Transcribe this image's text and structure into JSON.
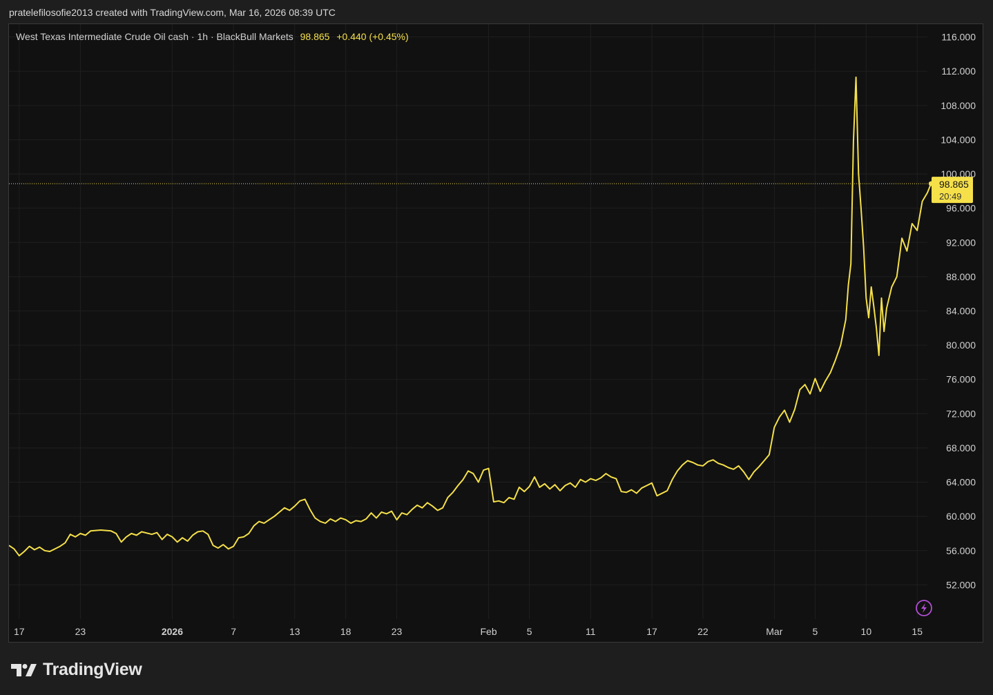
{
  "header": {
    "caption": "pratelefilosofie2013 created with TradingView.com, Mar 16, 2026 08:39 UTC"
  },
  "legend": {
    "symbol": "West Texas Intermediate Crude Oil cash · 1h · BlackBull Markets",
    "last": "98.865",
    "change": "+0.440 (+0.45%)"
  },
  "price_label": {
    "price": "98.865",
    "countdown": "20:49"
  },
  "footer": {
    "brand": "TradingView"
  },
  "colors": {
    "line": "#f5e04a",
    "background": "#111111",
    "grid": "#1f1f1f",
    "axis_text": "#d1d1d1"
  },
  "chart_data": {
    "type": "line",
    "title": "West Texas Intermediate Crude Oil cash · 1h · BlackBull Markets",
    "xlabel": "",
    "ylabel": "",
    "ylim": [
      48,
      117.5
    ],
    "yticks": [
      52,
      56,
      60,
      64,
      68,
      72,
      76,
      80,
      84,
      88,
      92,
      96,
      100,
      104,
      108,
      112,
      116
    ],
    "ytick_labels": [
      "52.000",
      "56.000",
      "60.000",
      "64.000",
      "68.000",
      "72.000",
      "76.000",
      "80.000",
      "84.000",
      "88.000",
      "92.000",
      "96.000",
      "100.000",
      "104.000",
      "108.000",
      "112.000",
      "116.000"
    ],
    "xlim": [
      "2025-12-16",
      "2026-03-16"
    ],
    "x_ticks": [
      {
        "date": "2025-12-17",
        "label": "17",
        "bold": false
      },
      {
        "date": "2025-12-23",
        "label": "23",
        "bold": false
      },
      {
        "date": "2026-01-01",
        "label": "2026",
        "bold": true
      },
      {
        "date": "2026-01-07",
        "label": "7",
        "bold": false
      },
      {
        "date": "2026-01-13",
        "label": "13",
        "bold": false
      },
      {
        "date": "2026-01-18",
        "label": "18",
        "bold": false
      },
      {
        "date": "2026-01-23",
        "label": "23",
        "bold": false
      },
      {
        "date": "2026-02-01",
        "label": "Feb",
        "bold": false
      },
      {
        "date": "2026-02-05",
        "label": "5",
        "bold": false
      },
      {
        "date": "2026-02-11",
        "label": "11",
        "bold": false
      },
      {
        "date": "2026-02-17",
        "label": "17",
        "bold": false
      },
      {
        "date": "2026-02-22",
        "label": "22",
        "bold": false
      },
      {
        "date": "2026-03-01",
        "label": "Mar",
        "bold": false
      },
      {
        "date": "2026-03-05",
        "label": "5",
        "bold": false
      },
      {
        "date": "2026-03-10",
        "label": "10",
        "bold": false
      },
      {
        "date": "2026-03-15",
        "label": "15",
        "bold": false
      }
    ],
    "last_value": 98.865,
    "grid": true,
    "series": [
      {
        "values": [
          [
            "2025-12-16 00:00",
            56.6
          ],
          [
            "2025-12-16 12:00",
            56.2
          ],
          [
            "2025-12-17 00:00",
            55.4
          ],
          [
            "2025-12-17 12:00",
            55.9
          ],
          [
            "2025-12-18 00:00",
            56.5
          ],
          [
            "2025-12-18 12:00",
            56.1
          ],
          [
            "2025-12-19 00:00",
            56.4
          ],
          [
            "2025-12-19 12:00",
            56.0
          ],
          [
            "2025-12-20 00:00",
            55.9
          ],
          [
            "2025-12-21 00:00",
            56.5
          ],
          [
            "2025-12-21 12:00",
            56.9
          ],
          [
            "2025-12-22 00:00",
            57.9
          ],
          [
            "2025-12-22 12:00",
            57.6
          ],
          [
            "2025-12-23 00:00",
            58.0
          ],
          [
            "2025-12-23 12:00",
            57.8
          ],
          [
            "2025-12-24 00:00",
            58.3
          ],
          [
            "2025-12-25 00:00",
            58.4
          ],
          [
            "2025-12-26 00:00",
            58.3
          ],
          [
            "2025-12-26 12:00",
            58.0
          ],
          [
            "2025-12-27 00:00",
            57.0
          ],
          [
            "2025-12-27 12:00",
            57.6
          ],
          [
            "2025-12-28 00:00",
            58.0
          ],
          [
            "2025-12-28 12:00",
            57.8
          ],
          [
            "2025-12-29 00:00",
            58.2
          ],
          [
            "2025-12-30 00:00",
            57.9
          ],
          [
            "2025-12-30 12:00",
            58.1
          ],
          [
            "2025-12-31 00:00",
            57.3
          ],
          [
            "2025-12-31 12:00",
            57.9
          ],
          [
            "2026-01-01 00:00",
            57.6
          ],
          [
            "2026-01-01 12:00",
            57.0
          ],
          [
            "2026-01-02 00:00",
            57.5
          ],
          [
            "2026-01-02 12:00",
            57.1
          ],
          [
            "2026-01-03 00:00",
            57.8
          ],
          [
            "2026-01-03 12:00",
            58.2
          ],
          [
            "2026-01-04 00:00",
            58.3
          ],
          [
            "2026-01-04 12:00",
            57.9
          ],
          [
            "2026-01-05 00:00",
            56.6
          ],
          [
            "2026-01-05 12:00",
            56.3
          ],
          [
            "2026-01-06 00:00",
            56.7
          ],
          [
            "2026-01-06 12:00",
            56.2
          ],
          [
            "2026-01-07 00:00",
            56.5
          ],
          [
            "2026-01-07 12:00",
            57.5
          ],
          [
            "2026-01-08 00:00",
            57.6
          ],
          [
            "2026-01-08 12:00",
            58.0
          ],
          [
            "2026-01-09 00:00",
            58.9
          ],
          [
            "2026-01-09 12:00",
            59.4
          ],
          [
            "2026-01-10 00:00",
            59.2
          ],
          [
            "2026-01-10 12:00",
            59.6
          ],
          [
            "2026-01-11 00:00",
            60.0
          ],
          [
            "2026-01-11 12:00",
            60.5
          ],
          [
            "2026-01-12 00:00",
            61.0
          ],
          [
            "2026-01-12 12:00",
            60.7
          ],
          [
            "2026-01-13 00:00",
            61.2
          ],
          [
            "2026-01-13 12:00",
            61.8
          ],
          [
            "2026-01-14 00:00",
            62.0
          ],
          [
            "2026-01-14 12:00",
            60.8
          ],
          [
            "2026-01-15 00:00",
            59.8
          ],
          [
            "2026-01-15 12:00",
            59.4
          ],
          [
            "2026-01-16 00:00",
            59.2
          ],
          [
            "2026-01-16 12:00",
            59.7
          ],
          [
            "2026-01-17 00:00",
            59.4
          ],
          [
            "2026-01-17 12:00",
            59.8
          ],
          [
            "2026-01-18 00:00",
            59.6
          ],
          [
            "2026-01-18 12:00",
            59.2
          ],
          [
            "2026-01-19 00:00",
            59.5
          ],
          [
            "2026-01-19 12:00",
            59.4
          ],
          [
            "2026-01-20 00:00",
            59.7
          ],
          [
            "2026-01-20 12:00",
            60.4
          ],
          [
            "2026-01-21 00:00",
            59.8
          ],
          [
            "2026-01-21 12:00",
            60.5
          ],
          [
            "2026-01-22 00:00",
            60.3
          ],
          [
            "2026-01-22 12:00",
            60.6
          ],
          [
            "2026-01-23 00:00",
            59.6
          ],
          [
            "2026-01-23 12:00",
            60.4
          ],
          [
            "2026-01-24 00:00",
            60.2
          ],
          [
            "2026-01-24 12:00",
            60.8
          ],
          [
            "2026-01-25 00:00",
            61.3
          ],
          [
            "2026-01-25 12:00",
            61.0
          ],
          [
            "2026-01-26 00:00",
            61.6
          ],
          [
            "2026-01-26 12:00",
            61.2
          ],
          [
            "2026-01-27 00:00",
            60.7
          ],
          [
            "2026-01-27 12:00",
            61.0
          ],
          [
            "2026-01-28 00:00",
            62.2
          ],
          [
            "2026-01-28 12:00",
            62.8
          ],
          [
            "2026-01-29 00:00",
            63.6
          ],
          [
            "2026-01-29 12:00",
            64.3
          ],
          [
            "2026-01-30 00:00",
            65.3
          ],
          [
            "2026-01-30 12:00",
            65.0
          ],
          [
            "2026-01-31 00:00",
            64.0
          ],
          [
            "2026-01-31 12:00",
            65.4
          ],
          [
            "2026-02-01 00:00",
            65.6
          ],
          [
            "2026-02-01 12:00",
            61.7
          ],
          [
            "2026-02-02 00:00",
            61.8
          ],
          [
            "2026-02-02 12:00",
            61.6
          ],
          [
            "2026-02-03 00:00",
            62.2
          ],
          [
            "2026-02-03 12:00",
            62.0
          ],
          [
            "2026-02-04 00:00",
            63.4
          ],
          [
            "2026-02-04 12:00",
            62.9
          ],
          [
            "2026-02-05 00:00",
            63.5
          ],
          [
            "2026-02-05 12:00",
            64.6
          ],
          [
            "2026-02-06 00:00",
            63.4
          ],
          [
            "2026-02-06 12:00",
            63.8
          ],
          [
            "2026-02-07 00:00",
            63.2
          ],
          [
            "2026-02-07 12:00",
            63.7
          ],
          [
            "2026-02-08 00:00",
            63.0
          ],
          [
            "2026-02-08 12:00",
            63.6
          ],
          [
            "2026-02-09 00:00",
            63.9
          ],
          [
            "2026-02-09 12:00",
            63.4
          ],
          [
            "2026-02-10 00:00",
            64.3
          ],
          [
            "2026-02-10 12:00",
            64.0
          ],
          [
            "2026-02-11 00:00",
            64.4
          ],
          [
            "2026-02-11 12:00",
            64.2
          ],
          [
            "2026-02-12 00:00",
            64.5
          ],
          [
            "2026-02-12 12:00",
            65.0
          ],
          [
            "2026-02-13 00:00",
            64.6
          ],
          [
            "2026-02-13 12:00",
            64.4
          ],
          [
            "2026-02-14 00:00",
            62.9
          ],
          [
            "2026-02-14 12:00",
            62.8
          ],
          [
            "2026-02-15 00:00",
            63.1
          ],
          [
            "2026-02-15 12:00",
            62.7
          ],
          [
            "2026-02-16 00:00",
            63.3
          ],
          [
            "2026-02-16 12:00",
            63.6
          ],
          [
            "2026-02-17 00:00",
            63.9
          ],
          [
            "2026-02-17 12:00",
            62.4
          ],
          [
            "2026-02-18 00:00",
            62.7
          ],
          [
            "2026-02-18 12:00",
            63.0
          ],
          [
            "2026-02-19 00:00",
            64.3
          ],
          [
            "2026-02-19 12:00",
            65.3
          ],
          [
            "2026-02-20 00:00",
            66.0
          ],
          [
            "2026-02-20 12:00",
            66.5
          ],
          [
            "2026-02-21 00:00",
            66.3
          ],
          [
            "2026-02-21 12:00",
            66.0
          ],
          [
            "2026-02-22 00:00",
            65.9
          ],
          [
            "2026-02-22 12:00",
            66.4
          ],
          [
            "2026-02-23 00:00",
            66.6
          ],
          [
            "2026-02-23 12:00",
            66.2
          ],
          [
            "2026-02-24 00:00",
            66.0
          ],
          [
            "2026-02-24 12:00",
            65.7
          ],
          [
            "2026-02-25 00:00",
            65.5
          ],
          [
            "2026-02-25 12:00",
            65.9
          ],
          [
            "2026-02-26 00:00",
            65.2
          ],
          [
            "2026-02-26 12:00",
            64.3
          ],
          [
            "2026-02-27 00:00",
            65.2
          ],
          [
            "2026-02-27 12:00",
            65.8
          ],
          [
            "2026-02-28 00:00",
            66.5
          ],
          [
            "2026-02-28 12:00",
            67.2
          ],
          [
            "2026-03-01 00:00",
            70.4
          ],
          [
            "2026-03-01 12:00",
            71.6
          ],
          [
            "2026-03-02 00:00",
            72.4
          ],
          [
            "2026-03-02 12:00",
            71.0
          ],
          [
            "2026-03-03 00:00",
            72.5
          ],
          [
            "2026-03-03 12:00",
            74.8
          ],
          [
            "2026-03-04 00:00",
            75.4
          ],
          [
            "2026-03-04 12:00",
            74.3
          ],
          [
            "2026-03-05 00:00",
            76.1
          ],
          [
            "2026-03-05 12:00",
            74.6
          ],
          [
            "2026-03-06 00:00",
            75.8
          ],
          [
            "2026-03-06 12:00",
            76.8
          ],
          [
            "2026-03-07 00:00",
            78.3
          ],
          [
            "2026-03-07 12:00",
            80.0
          ],
          [
            "2026-03-08 00:00",
            83.0
          ],
          [
            "2026-03-08 06:00",
            87.0
          ],
          [
            "2026-03-08 12:00",
            89.5
          ],
          [
            "2026-03-08 18:00",
            103.8
          ],
          [
            "2026-03-09 00:00",
            111.3
          ],
          [
            "2026-03-09 06:00",
            100.0
          ],
          [
            "2026-03-09 12:00",
            96.0
          ],
          [
            "2026-03-09 18:00",
            91.5
          ],
          [
            "2026-03-10 00:00",
            85.5
          ],
          [
            "2026-03-10 06:00",
            83.2
          ],
          [
            "2026-03-10 12:00",
            86.8
          ],
          [
            "2026-03-10 18:00",
            84.5
          ],
          [
            "2026-03-11 00:00",
            82.0
          ],
          [
            "2026-03-11 06:00",
            78.8
          ],
          [
            "2026-03-11 12:00",
            85.5
          ],
          [
            "2026-03-11 18:00",
            81.6
          ],
          [
            "2026-03-12 00:00",
            84.3
          ],
          [
            "2026-03-12 12:00",
            86.8
          ],
          [
            "2026-03-13 00:00",
            88.0
          ],
          [
            "2026-03-13 12:00",
            92.5
          ],
          [
            "2026-03-14 00:00",
            91.0
          ],
          [
            "2026-03-14 12:00",
            94.2
          ],
          [
            "2026-03-15 00:00",
            93.4
          ],
          [
            "2026-03-15 12:00",
            96.8
          ],
          [
            "2026-03-16 00:00",
            97.8
          ],
          [
            "2026-03-16 08:39",
            98.865
          ]
        ]
      }
    ]
  }
}
